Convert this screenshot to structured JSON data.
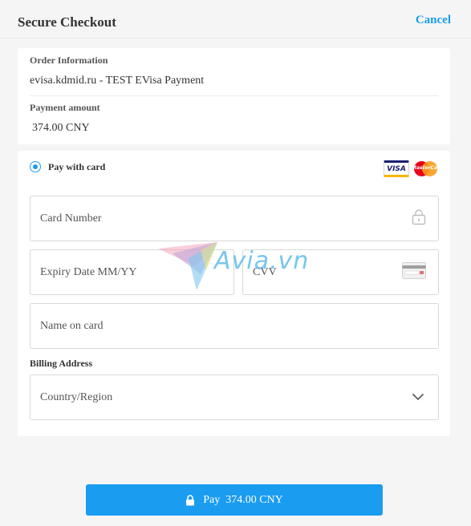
{
  "header": {
    "title": "Secure Checkout",
    "cancel_label": "Cancel"
  },
  "order": {
    "info_label": "Order Information",
    "info_value": "evisa.kdmid.ru - TEST EVisa Payment",
    "amount_label": "Payment amount",
    "amount_value": "374.00 CNY"
  },
  "payment": {
    "method_label": "Pay with card",
    "card_brands": [
      {
        "name": "VISA",
        "icon": "visa-logo"
      },
      {
        "name": "MasterCard",
        "icon": "mastercard-logo"
      }
    ],
    "card_number_placeholder": "Card Number",
    "expiry_placeholder": "Expiry Date MM/YY",
    "cvv_placeholder": "CVV",
    "name_placeholder": "Name on card",
    "billing_label": "Billing Address",
    "country_placeholder": "Country/Region"
  },
  "watermark": {
    "text": "Avia.vn"
  },
  "pay_button": {
    "label": "Pay  374.00 CNY"
  },
  "colors": {
    "accent": "#1a9cf0",
    "background": "#f5f5f5",
    "card": "#ffffff"
  }
}
